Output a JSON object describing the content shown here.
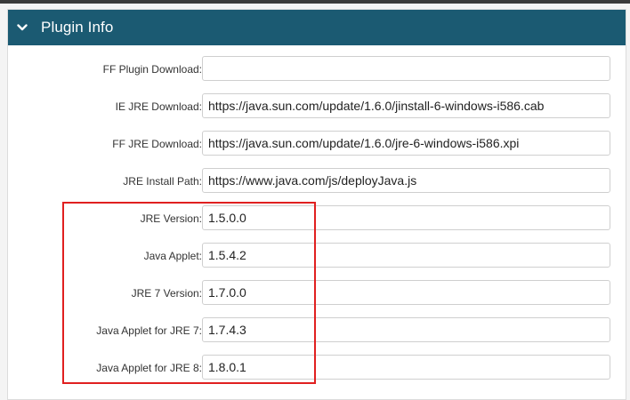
{
  "panel": {
    "title": "Plugin Info",
    "toggle_icon": "chevron-down-icon",
    "header_color": "#1b5a72"
  },
  "fields": [
    {
      "label": "FF Plugin Download:",
      "value": ""
    },
    {
      "label": "IE JRE Download:",
      "value": "https://java.sun.com/update/1.6.0/jinstall-6-windows-i586.cab"
    },
    {
      "label": "FF JRE Download:",
      "value": "https://java.sun.com/update/1.6.0/jre-6-windows-i586.xpi"
    },
    {
      "label": "JRE Install Path:",
      "value": "https://www.java.com/js/deployJava.js"
    },
    {
      "label": "JRE Version:",
      "value": "1.5.0.0"
    },
    {
      "label": "Java Applet:",
      "value": "1.5.4.2"
    },
    {
      "label": "JRE 7 Version:",
      "value": "1.7.0.0"
    },
    {
      "label": "Java Applet for JRE 7:",
      "value": "1.7.4.3"
    },
    {
      "label": "Java Applet for JRE 8:",
      "value": "1.8.0.1"
    }
  ],
  "highlight_color": "#e02020"
}
